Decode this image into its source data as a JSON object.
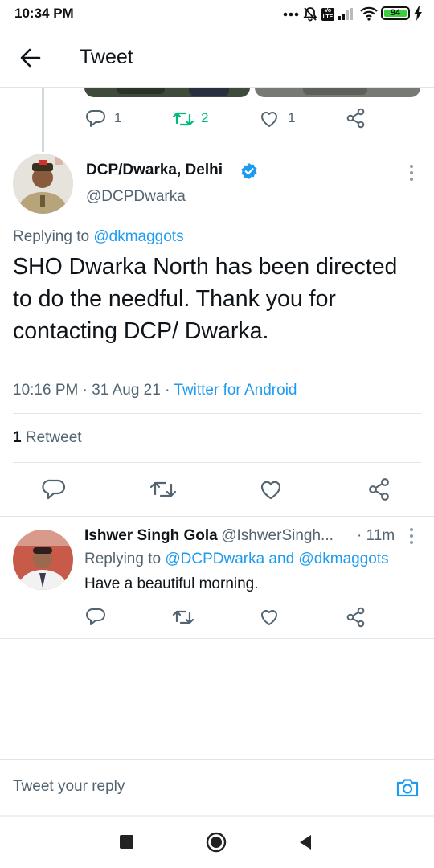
{
  "status_bar": {
    "time": "10:34 PM",
    "battery": "94",
    "volte": "Vo LTE"
  },
  "header": {
    "title": "Tweet"
  },
  "prev_tweet_actions": {
    "replies": "1",
    "retweets": "2",
    "likes": "1"
  },
  "tweet": {
    "display_name": "DCP/Dwarka, Delhi",
    "handle": "@DCPDwarka",
    "replying_prefix": "Replying to",
    "replying_to": "@dkmaggots",
    "text": "SHO Dwarka North has been directed to do the needful. Thank you for contacting DCP/ Dwarka.",
    "time": "10:16 PM",
    "date": "31 Aug 21",
    "source": "Twitter for Android",
    "retweet_count": "1",
    "retweet_label": "Retweet"
  },
  "reply": {
    "display_name": "Ishwer Singh Gola",
    "handle": "@IshwerSingh...",
    "age": "· 11m",
    "replying_prefix": "Replying to",
    "replying_to": "@DCPDwarka and @dkmaggots",
    "text": "Have a beautiful morning."
  },
  "composer": {
    "placeholder": "Tweet your reply"
  },
  "colors": {
    "accent": "#1d9bf0",
    "retweet_green": "#00ba7c",
    "muted": "#536471"
  },
  "icons": [
    "back-arrow-icon",
    "reply-icon",
    "retweet-icon",
    "like-icon",
    "share-icon",
    "verified-icon",
    "more-icon",
    "camera-icon",
    "nav-square-icon",
    "nav-circle-icon",
    "nav-back-icon",
    "silent-bell-icon",
    "wifi-icon",
    "signal-icon",
    "charging-icon"
  ]
}
